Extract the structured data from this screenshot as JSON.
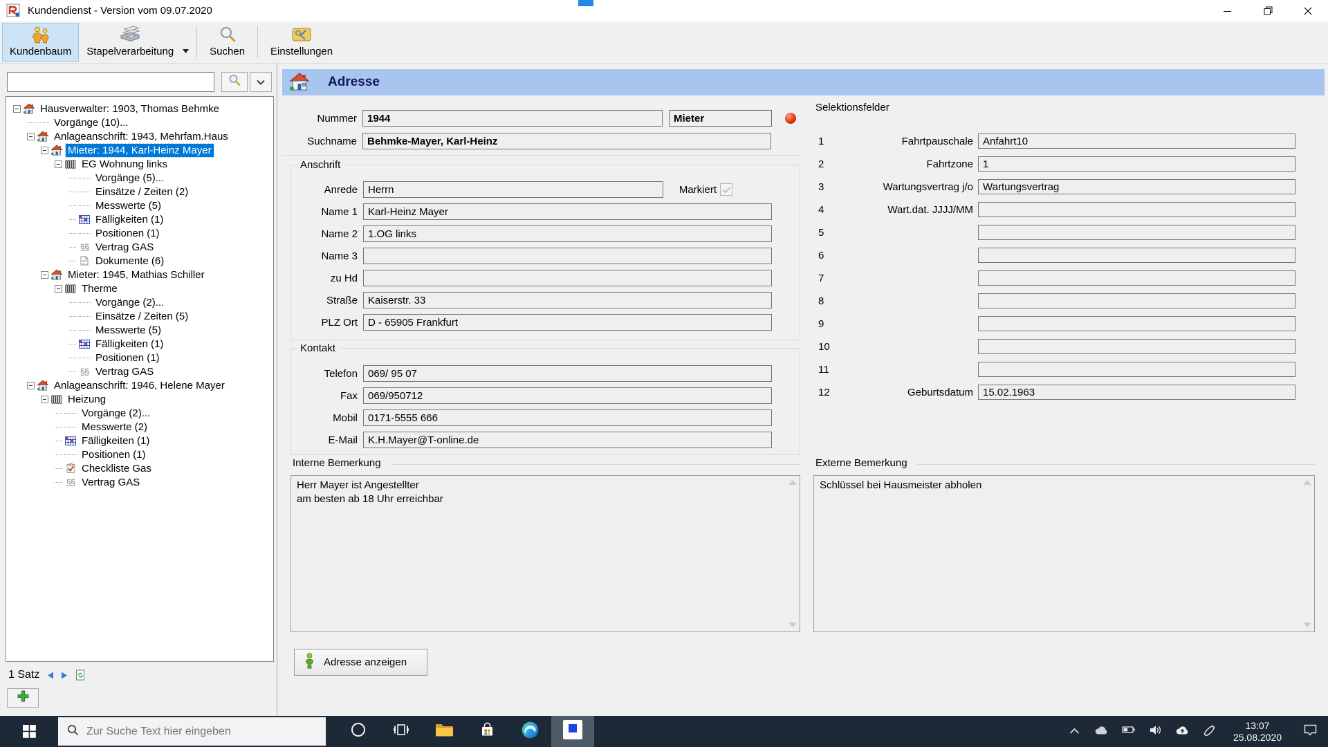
{
  "colors": {
    "header_bar": "#a8c5ef",
    "tree_selection": "#0078d7",
    "taskbar_bg": "#1d2936",
    "toolbar_selected_bg": "#cde4f7",
    "status_ball": "#e23b12"
  },
  "window": {
    "title": "Kundendienst - Version vom 09.07.2020"
  },
  "toolbar": {
    "buttons": [
      {
        "label": "Kundenbaum",
        "icon": "kundenbaum-icon",
        "selected": true,
        "sep_before": false,
        "dropdown": false
      },
      {
        "label": "Stapelverarbeitung",
        "icon": "stapelverarbeitung-icon",
        "selected": false,
        "sep_before": false,
        "dropdown": true
      },
      {
        "label": "Suchen",
        "icon": "suchen-icon",
        "selected": false,
        "sep_before": true,
        "dropdown": false
      },
      {
        "label": "Einstellungen",
        "icon": "einstellungen-icon",
        "selected": false,
        "sep_before": true,
        "dropdown": false
      }
    ]
  },
  "sidebar": {
    "search": {
      "value": ""
    },
    "tree": [
      {
        "depth": 0,
        "expander": true,
        "icon": "house",
        "label": "Hausverwalter: 1903, Thomas Behmke",
        "selected": false
      },
      {
        "depth": 1,
        "expander": false,
        "icon": null,
        "label": "Vorgänge (10)...",
        "selected": false
      },
      {
        "depth": 1,
        "expander": true,
        "icon": "house",
        "label": "Anlageanschrift: 1943, Mehrfam.Haus",
        "selected": false
      },
      {
        "depth": 2,
        "expander": true,
        "icon": "house",
        "label": "Mieter: 1944, Karl-Heinz Mayer",
        "selected": true
      },
      {
        "depth": 3,
        "expander": true,
        "icon": "radiator",
        "label": "EG Wohnung links",
        "selected": false
      },
      {
        "depth": 4,
        "expander": false,
        "icon": null,
        "label": "Vorgänge (5)...",
        "selected": false
      },
      {
        "depth": 4,
        "expander": false,
        "icon": null,
        "label": "Einsätze / Zeiten (2)",
        "selected": false
      },
      {
        "depth": 4,
        "expander": false,
        "icon": null,
        "label": "Messwerte (5)",
        "selected": false
      },
      {
        "depth": 4,
        "expander": false,
        "icon": "grid",
        "label": "Fälligkeiten (1)",
        "selected": false
      },
      {
        "depth": 4,
        "expander": false,
        "icon": null,
        "label": "Positionen (1)",
        "selected": false
      },
      {
        "depth": 4,
        "expander": false,
        "icon": "paragraph",
        "label": "Vertrag GAS",
        "selected": false
      },
      {
        "depth": 4,
        "expander": false,
        "icon": "document",
        "label": "Dokumente (6)",
        "selected": false
      },
      {
        "depth": 2,
        "expander": true,
        "icon": "house",
        "label": "Mieter: 1945, Mathias Schiller",
        "selected": false
      },
      {
        "depth": 3,
        "expander": true,
        "icon": "radiator",
        "label": "Therme",
        "selected": false
      },
      {
        "depth": 4,
        "expander": false,
        "icon": null,
        "label": "Vorgänge (2)...",
        "selected": false
      },
      {
        "depth": 4,
        "expander": false,
        "icon": null,
        "label": "Einsätze / Zeiten (5)",
        "selected": false
      },
      {
        "depth": 4,
        "expander": false,
        "icon": null,
        "label": "Messwerte (5)",
        "selected": false
      },
      {
        "depth": 4,
        "expander": false,
        "icon": "grid",
        "label": "Fälligkeiten (1)",
        "selected": false
      },
      {
        "depth": 4,
        "expander": false,
        "icon": null,
        "label": "Positionen (1)",
        "selected": false
      },
      {
        "depth": 4,
        "expander": false,
        "icon": "paragraph",
        "label": "Vertrag GAS",
        "selected": false
      },
      {
        "depth": 1,
        "expander": true,
        "icon": "house",
        "label": "Anlageanschrift: 1946, Helene Mayer",
        "selected": false
      },
      {
        "depth": 2,
        "expander": true,
        "icon": "radiator",
        "label": "Heizung",
        "selected": false
      },
      {
        "depth": 3,
        "expander": false,
        "icon": null,
        "label": "Vorgänge (2)...",
        "selected": false
      },
      {
        "depth": 3,
        "expander": false,
        "icon": null,
        "label": "Messwerte (2)",
        "selected": false
      },
      {
        "depth": 3,
        "expander": false,
        "icon": "grid",
        "label": "Fälligkeiten (1)",
        "selected": false
      },
      {
        "depth": 3,
        "expander": false,
        "icon": null,
        "label": "Positionen (1)",
        "selected": false
      },
      {
        "depth": 3,
        "expander": false,
        "icon": "checklist",
        "label": "Checkliste Gas",
        "selected": false
      },
      {
        "depth": 3,
        "expander": false,
        "icon": "paragraph",
        "label": "Vertrag GAS",
        "selected": false
      }
    ],
    "status": {
      "label": "1 Satz"
    }
  },
  "main": {
    "header": {
      "title": "Adresse"
    },
    "identity": {
      "nummer_label": "Nummer",
      "nummer_value": "1944",
      "type_value": "Mieter",
      "suchname_label": "Suchname",
      "suchname_value": "Behmke-Mayer, Karl-Heinz"
    },
    "anschrift": {
      "title": "Anschrift",
      "markiert": {
        "label": "Markiert",
        "checked": true
      },
      "rows": [
        {
          "label": "Anrede",
          "value": "Herrn",
          "short": true,
          "markiert": true
        },
        {
          "label": "Name 1",
          "value": "Karl-Heinz Mayer",
          "short": false,
          "markiert": false
        },
        {
          "label": "Name 2",
          "value": "1.OG links",
          "short": false,
          "markiert": false
        },
        {
          "label": "Name 3",
          "value": "",
          "short": false,
          "markiert": false
        },
        {
          "label": "zu Hd",
          "value": "",
          "short": false,
          "markiert": false
        },
        {
          "label": "Straße",
          "value": "Kaiserstr. 33",
          "short": false,
          "markiert": false
        },
        {
          "label": "PLZ Ort",
          "value": "D - 65905 Frankfurt",
          "short": false,
          "markiert": false
        }
      ]
    },
    "kontakt": {
      "title": "Kontakt",
      "rows": [
        {
          "label": "Telefon",
          "value": "069/ 95 07"
        },
        {
          "label": "Fax",
          "value": "069/950712"
        },
        {
          "label": "Mobil",
          "value": "0171-5555 666"
        },
        {
          "label": "E-Mail",
          "value": "K.H.Mayer@T-online.de"
        }
      ]
    },
    "interne_bemerkung": {
      "title": "Interne Bemerkung",
      "lines": [
        "Herr Mayer ist Angestellter",
        "am besten ab 18 Uhr erreichbar"
      ]
    },
    "externe_bemerkung": {
      "title": "Externe Bemerkung",
      "lines": [
        "Schlüssel bei Hausmeister abholen"
      ]
    },
    "actions": {
      "show_address": "Adresse anzeigen"
    },
    "selektionsfelder": {
      "title": "Selektionsfelder",
      "rows": [
        {
          "num": "1",
          "label": "Fahrtpauschale",
          "value": "Anfahrt10"
        },
        {
          "num": "2",
          "label": "Fahrtzone",
          "value": "1"
        },
        {
          "num": "3",
          "label": "Wartungsvertrag j/o",
          "value": "Wartungsvertrag"
        },
        {
          "num": "4",
          "label": "Wart.dat. JJJJ/MM",
          "value": ""
        },
        {
          "num": "5",
          "label": "",
          "value": ""
        },
        {
          "num": "6",
          "label": "",
          "value": ""
        },
        {
          "num": "7",
          "label": "",
          "value": ""
        },
        {
          "num": "8",
          "label": "",
          "value": ""
        },
        {
          "num": "9",
          "label": "",
          "value": ""
        },
        {
          "num": "10",
          "label": "",
          "value": ""
        },
        {
          "num": "11",
          "label": "",
          "value": ""
        },
        {
          "num": "12",
          "label": "Geburtsdatum",
          "value": "15.02.1963"
        }
      ]
    }
  },
  "taskbar": {
    "search_placeholder": "Zur Suche Text hier eingeben",
    "clock": {
      "time": "13:07",
      "date": "25.08.2020"
    }
  }
}
